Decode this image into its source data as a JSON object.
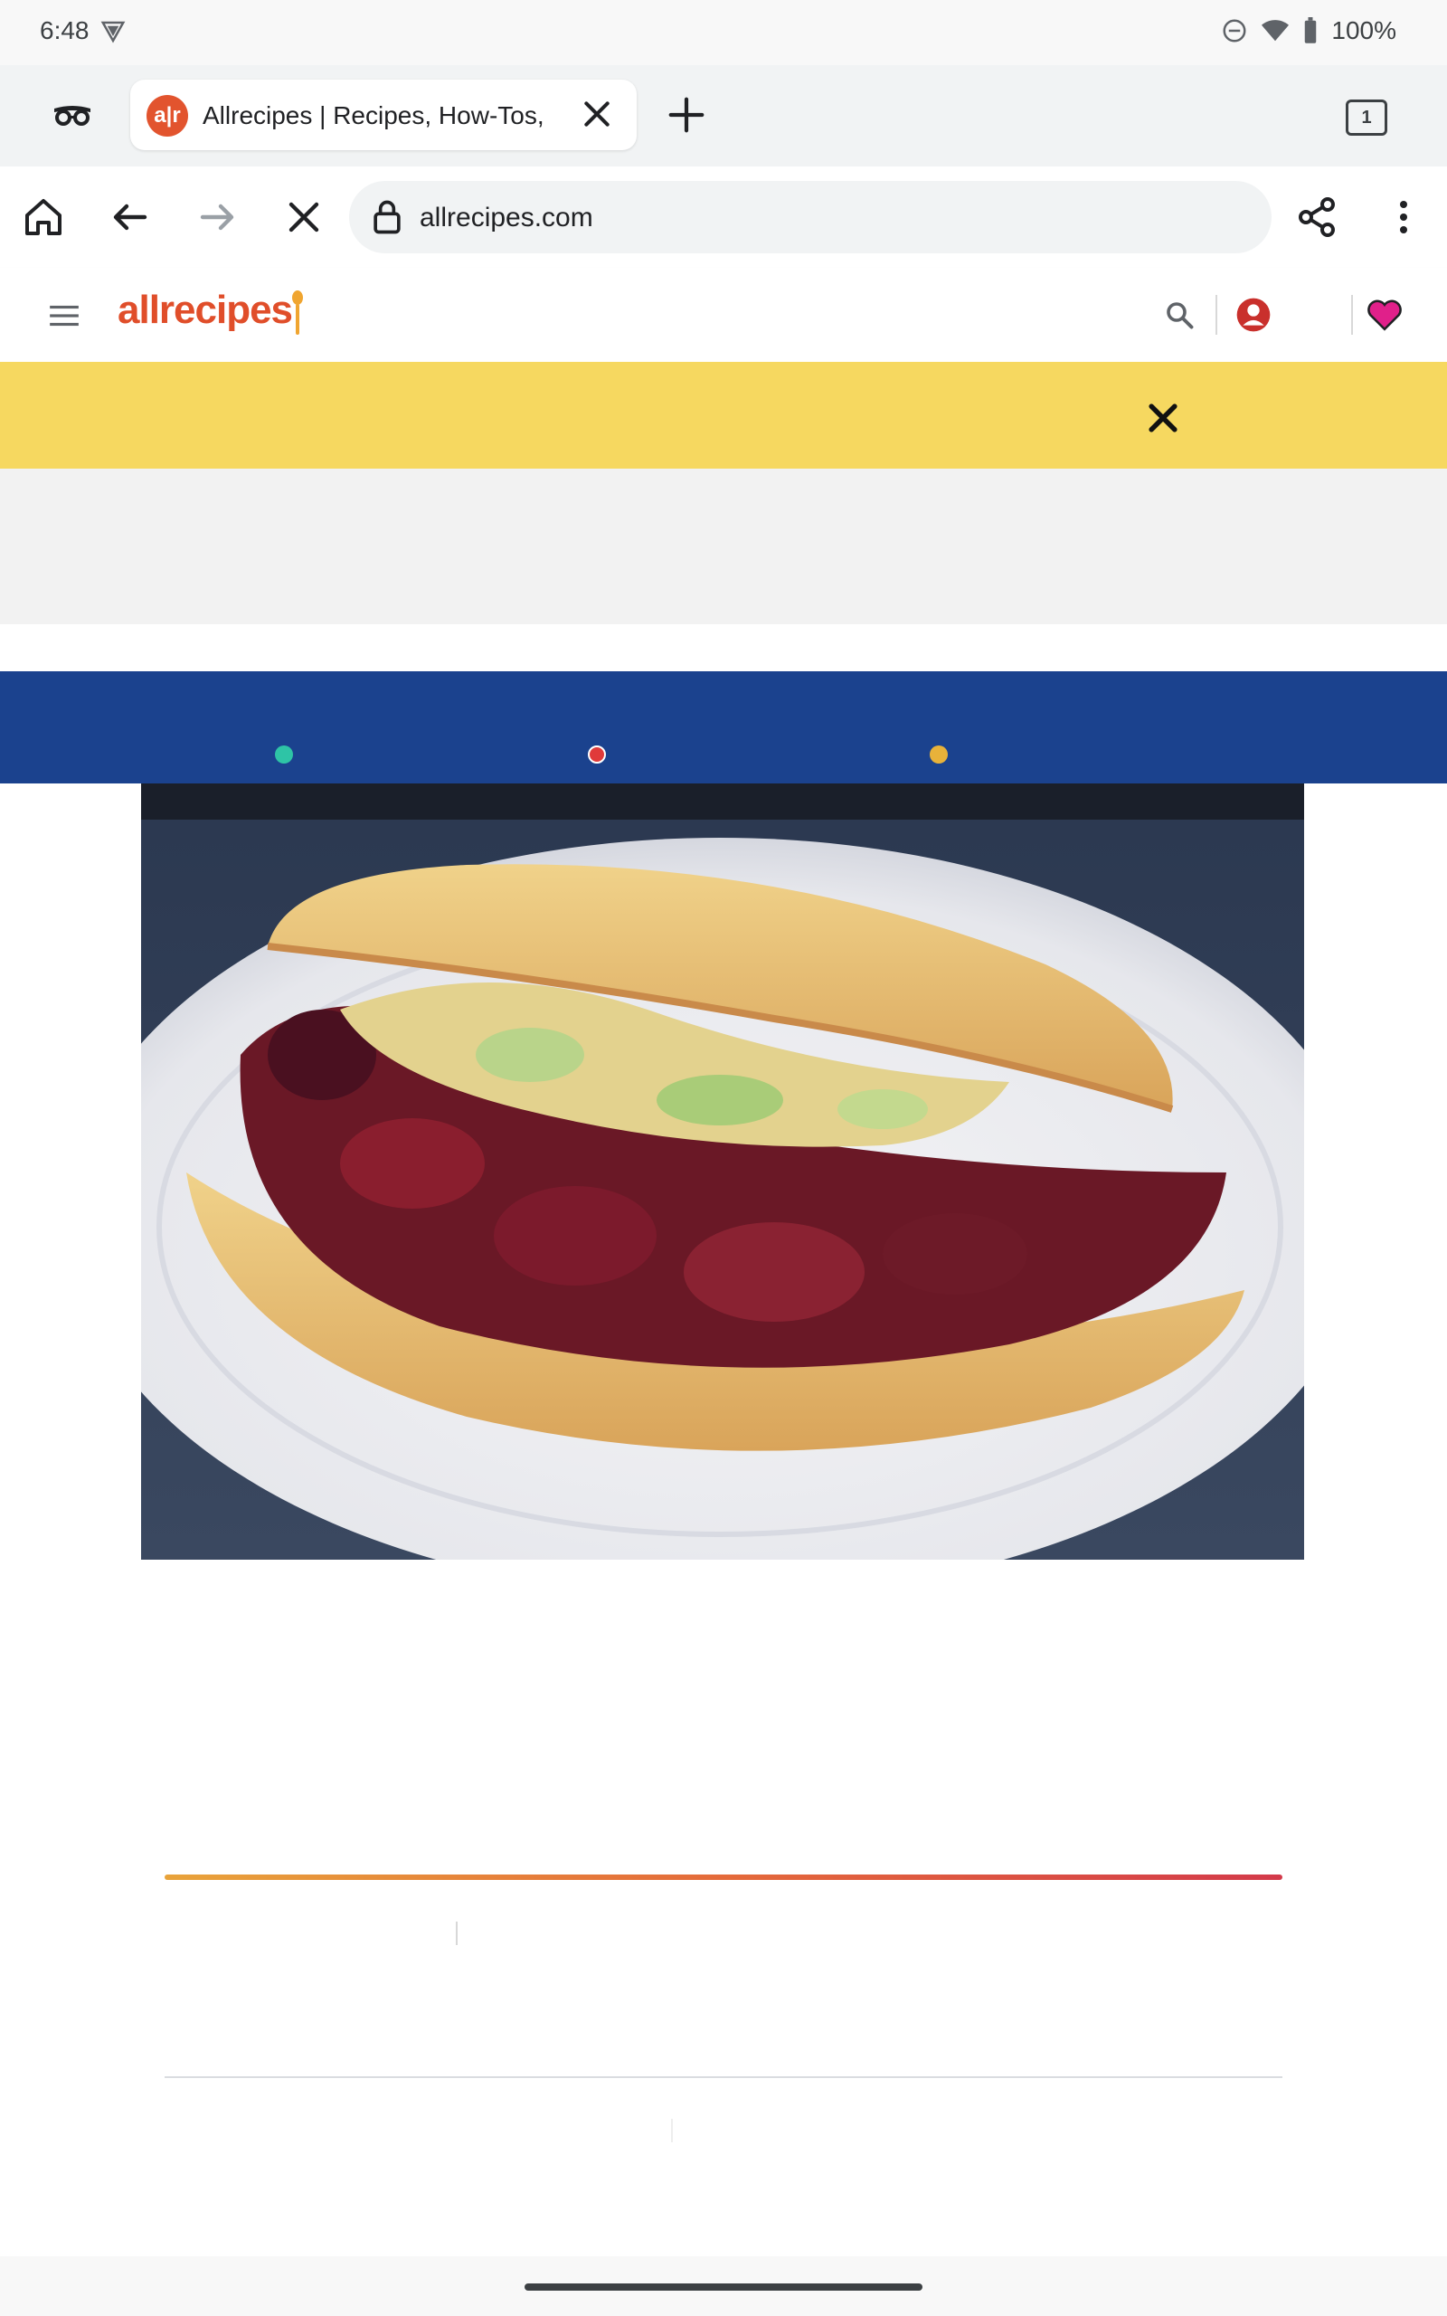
{
  "status_bar": {
    "time": "6:48",
    "battery": "100%"
  },
  "browser": {
    "tab": {
      "title": "Allrecipes | Recipes, How-Tos,",
      "favicon_text": "a|r"
    },
    "tab_count": "1",
    "url": "allrecipes.com"
  },
  "site": {
    "logo_text": "allrecipes",
    "brand_color": "#e04e2a",
    "banner_color": "#f6d860",
    "nav_band_color": "#1b428e",
    "dot_colors": [
      "#2ec4a6",
      "#e03a3a",
      "#e8b23a"
    ]
  },
  "icons": {
    "vpn": "vpn-key-icon",
    "dnd": "do-not-disturb-icon",
    "wifi": "wifi-icon",
    "battery": "battery-icon",
    "incognito": "incognito-icon",
    "close_tab": "close-icon",
    "new_tab": "plus-icon",
    "home": "home-icon",
    "back": "arrow-left-icon",
    "forward": "arrow-right-icon",
    "stop": "close-icon",
    "lock": "lock-icon",
    "share": "share-icon",
    "menu": "more-vert-icon",
    "hamburger": "hamburger-menu-icon",
    "search": "search-icon",
    "account": "account-icon",
    "favorites": "heart-icon",
    "banner_close": "close-icon"
  }
}
